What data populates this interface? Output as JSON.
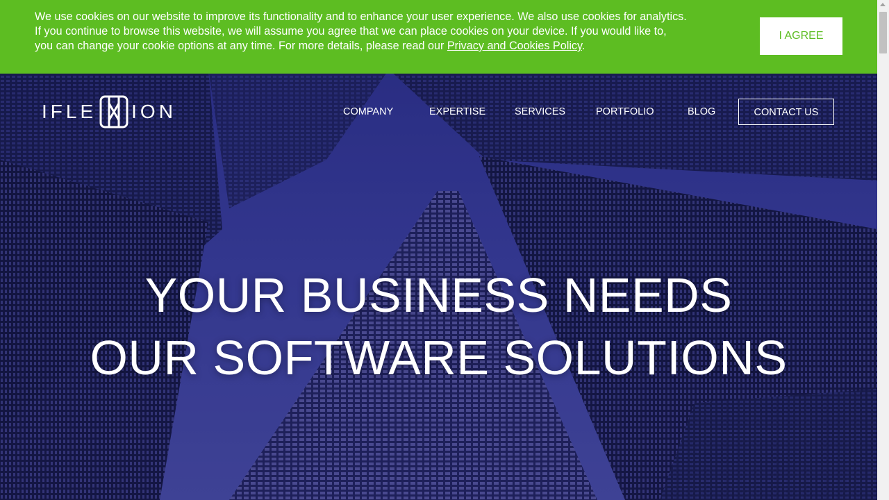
{
  "cookie_banner": {
    "text": "We use cookies on our website to improve its functionality and to enhance your user experience. We also use cookies for analytics. If you continue to browse this website, we will assume you agree that we can place cookies on your device. If you would like to, you can change your cookie options at any time. For more details, please read our ",
    "link_label": "Privacy and Cookies Policy",
    "text_end": ".",
    "agree_label": "I AGREE",
    "color": "#5dbd22"
  },
  "header": {
    "logo_left": "IFLE",
    "logo_right": "ION",
    "nav": [
      {
        "label": "COMPANY"
      },
      {
        "label": "EXPERTISE"
      },
      {
        "label": "SERVICES"
      },
      {
        "label": "PORTFOLIO"
      },
      {
        "label": "BLOG"
      }
    ],
    "contact_label": "CONTACT US"
  },
  "hero": {
    "line1": "YOUR BUSINESS NEEDS",
    "line2": "OUR SOFTWARE SOLUTIONS",
    "background": "night-skyscrapers-image"
  }
}
